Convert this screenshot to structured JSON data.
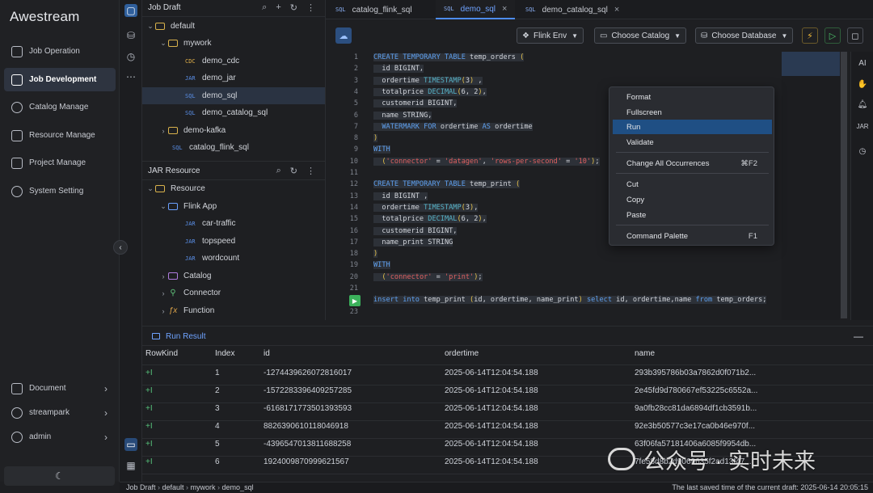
{
  "app": {
    "brand": "Awestream"
  },
  "nav": {
    "items": [
      {
        "label": "Job Operation"
      },
      {
        "label": "Job Development"
      },
      {
        "label": "Catalog Manage"
      },
      {
        "label": "Resource Manage"
      },
      {
        "label": "Project Manage"
      },
      {
        "label": "System Setting"
      }
    ],
    "bottom": [
      {
        "label": "Document"
      },
      {
        "label": "streampark"
      },
      {
        "label": "admin"
      }
    ]
  },
  "explorer": {
    "job_draft_title": "Job Draft",
    "tree": [
      {
        "label": "default",
        "kind": "folder"
      },
      {
        "label": "mywork",
        "kind": "folder"
      },
      {
        "label": "demo_cdc",
        "tag": "CDC"
      },
      {
        "label": "demo_jar",
        "tag": "JAR"
      },
      {
        "label": "demo_sql",
        "tag": "SQL"
      },
      {
        "label": "demo_catalog_sql",
        "tag": "SQL"
      },
      {
        "label": "demo-kafka",
        "kind": "folder"
      },
      {
        "label": "catalog_flink_sql",
        "tag": "SQL"
      }
    ],
    "jar_resource_title": "JAR Resource",
    "resources": [
      {
        "label": "Resource"
      },
      {
        "label": "Flink App"
      },
      {
        "label": "car-traffic",
        "tag": "JAR"
      },
      {
        "label": "topspeed",
        "tag": "JAR"
      },
      {
        "label": "wordcount",
        "tag": "JAR"
      },
      {
        "label": "Catalog"
      },
      {
        "label": "Connector"
      },
      {
        "label": "Function"
      }
    ]
  },
  "tabs": [
    {
      "tag": "SQL",
      "label": "catalog_flink_sql"
    },
    {
      "tag": "SQL",
      "label": "demo_sql"
    },
    {
      "tag": "SQL",
      "label": "demo_catalog_sql"
    }
  ],
  "toolbar": {
    "flink_env": "Flink Env",
    "choose_catalog": "Choose Catalog",
    "choose_database": "Choose Database"
  },
  "code": [
    [
      "CREATE TEMPORARY TABLE temp_orders ("
    ],
    [
      "  id BIGINT,"
    ],
    [
      "  ordertime TIMESTAMP(3) ,"
    ],
    [
      "  totalprice DECIMAL(6, 2),"
    ],
    [
      "  customerid BIGINT,"
    ],
    [
      "  name STRING,"
    ],
    [
      "  WATERMARK FOR ordertime AS ordertime"
    ],
    [
      ")"
    ],
    [
      "WITH"
    ],
    [
      "  ('connector' = 'datagen', 'rows-per-second' = '10');"
    ],
    [
      ""
    ],
    [
      "CREATE TEMPORARY TABLE temp_print ("
    ],
    [
      "  id BIGINT ,"
    ],
    [
      "  ordertime TIMESTAMP(3),"
    ],
    [
      "  totalprice DECIMAL(6, 2),"
    ],
    [
      "  customerid BIGINT,"
    ],
    [
      "  name_print STRING"
    ],
    [
      ")"
    ],
    [
      "WITH"
    ],
    [
      "  ('connector' = 'print');"
    ],
    [
      ""
    ],
    [
      "insert into temp_print (id, ordertime, name_print) select id, ordertime,name from temp_orders;"
    ],
    [
      ""
    ]
  ],
  "line_numbers": [
    "1",
    "2",
    "3",
    "4",
    "5",
    "6",
    "7",
    "8",
    "9",
    "10",
    "11",
    "12",
    "13",
    "14",
    "15",
    "16",
    "17",
    "18",
    "19",
    "20",
    "21",
    "22",
    "23"
  ],
  "rail": {
    "ai": "AI",
    "jar": "JAR"
  },
  "context_menu": {
    "format": "Format",
    "fullscreen": "Fullscreen",
    "run": "Run",
    "validate": "Validate",
    "change_all": "Change All Occurrences",
    "change_all_kb": "⌘F2",
    "cut": "Cut",
    "copy": "Copy",
    "paste": "Paste",
    "palette": "Command Palette",
    "palette_kb": "F1"
  },
  "results": {
    "tab_label": "Run Result",
    "columns": [
      "RowKind",
      "Index",
      "id",
      "ordertime",
      "name"
    ],
    "rows": [
      [
        "+I",
        "1",
        "-1274439626072816017",
        "2025-06-14T12:04:54.188",
        "293b395786b03a7862d0f071b2..."
      ],
      [
        "+I",
        "2",
        "-1572283396409257285",
        "2025-06-14T12:04:54.188",
        "2e45fd9d780667ef53225c6552a..."
      ],
      [
        "+I",
        "3",
        "-6168171773501393593",
        "2025-06-14T12:04:54.188",
        "9a0fb28cc81da6894df1cb3591b..."
      ],
      [
        "+I",
        "4",
        "8826390610118046918",
        "2025-06-14T12:04:54.188",
        "92e3b50577c3e17ca0b46e970f..."
      ],
      [
        "+I",
        "5",
        "-4396547013811688258",
        "2025-06-14T12:04:54.188",
        "63f06fa57181406a6085f9954db..."
      ],
      [
        "+I",
        "6",
        "1924009870999621567",
        "2025-06-14T12:04:54.188",
        "7fe58d8b2d9069635f2ad13f47..."
      ]
    ]
  },
  "status": {
    "crumbs": [
      "Job Draft",
      "default",
      "mywork",
      "demo_sql"
    ],
    "saved": "The last saved time of the current draft: 2025-06-14 20:05:15"
  },
  "watermark": "公众号 · 实时未来"
}
